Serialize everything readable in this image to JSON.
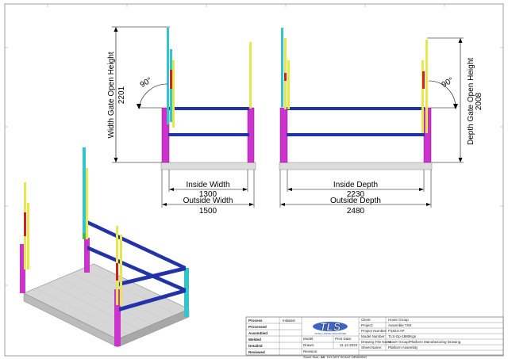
{
  "dimensions": {
    "angle_left": "90°",
    "angle_right": "90°",
    "width_gate_label": "Width Gate Open Height",
    "width_gate_value": "2201",
    "depth_gate_label": "Depth Gate Open Height",
    "depth_gate_value": "2008",
    "inside_width_label": "Inside Width",
    "inside_width_value": "1300",
    "outside_width_label": "Outside Width",
    "outside_width_value": "1500",
    "inside_depth_label": "Inside Depth",
    "inside_depth_value": "2230",
    "outside_depth_label": "Outside Depth",
    "outside_depth_value": "2480"
  },
  "title_block": {
    "rows": [
      {
        "label": "Process",
        "value": "Initialed"
      },
      {
        "label": "Processed",
        "value": ""
      },
      {
        "label": "Assembled",
        "value": ""
      },
      {
        "label": "Welded",
        "value": ""
      },
      {
        "label": "Detailed",
        "value": ""
      },
      {
        "label": "Reviewed",
        "value": ""
      }
    ],
    "model_label": "Model:",
    "drawn_label": "Drawn:",
    "revision_label": "Revision:",
    "print_date_label": "Print Date:",
    "print_date_value": "11.12.2023",
    "logo_text": "TLS",
    "logo_sub": "TOTAL LIFTING SOLUTIONS",
    "info": [
      {
        "label": "Client:",
        "value": "Hoxer Group"
      },
      {
        "label": "Project:",
        "value": "Assemble TSK"
      },
      {
        "label": "Project Number:",
        "value": "P1823-AP"
      },
      {
        "label": "Model Number:",
        "value": "TLS-Gp-1880Kgs"
      },
      {
        "label": "Drawing File Name:",
        "value": "Hoxer Group/Platform Manufacturing Drawing"
      },
      {
        "label": "Sheet Name:",
        "value": "Platform Assembly"
      }
    ],
    "sheet_size_label": "Sheet Size:",
    "sheet_size_value": "A0",
    "scale_note": "DO NOT SCALE DRAWING"
  }
}
